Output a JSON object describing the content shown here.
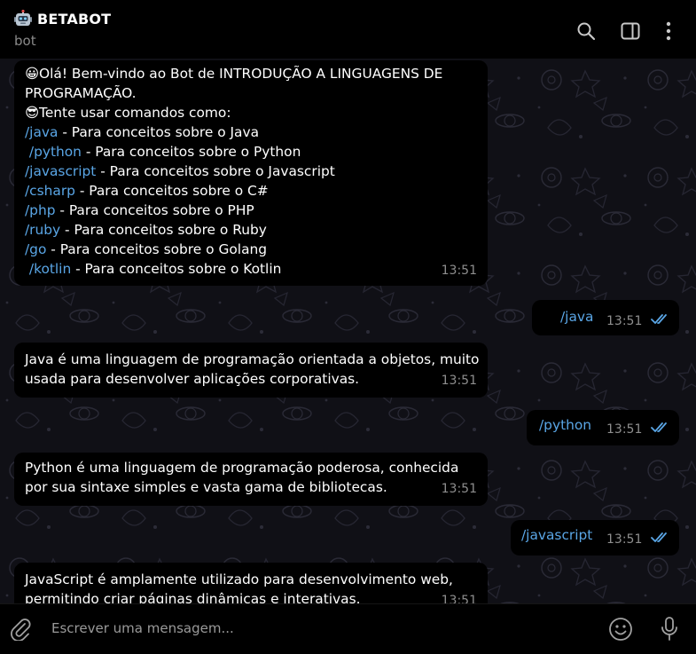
{
  "header": {
    "title": "BETABOT",
    "status": "bot",
    "bot_icon": "robot-face-icon",
    "actions": [
      "search-icon",
      "sidebar-toggle-icon",
      "more-vertical-icon"
    ]
  },
  "messages": [
    {
      "type": "incoming",
      "time": "13:51",
      "lines": [
        {
          "emoji": "😀",
          "text": "Olá! Bem-vindo ao Bot de INTRODUÇÃO A LINGUAGENS DE"
        },
        {
          "text": "PROGRAMAÇÃO."
        },
        {
          "emoji": "😎",
          "text": "Tente usar comandos como:"
        },
        {
          "cmd": "/java",
          "text": " - Para conceitos sobre o Java"
        },
        {
          "cmd": " /python",
          "text": " - Para conceitos sobre o Python"
        },
        {
          "cmd": "/javascript",
          "text": " - Para conceitos sobre o Javascript"
        },
        {
          "cmd": "/csharp",
          "text": " - Para conceitos sobre o C#"
        },
        {
          "cmd": "/php",
          "text": " - Para conceitos sobre o PHP"
        },
        {
          "cmd": "/ruby",
          "text": " - Para conceitos sobre o Ruby"
        },
        {
          "cmd": "/go",
          "text": " - Para conceitos sobre o Golang"
        },
        {
          "cmd": " /kotlin",
          "text": " - Para conceitos sobre o Kotlin"
        }
      ]
    },
    {
      "type": "outgoing",
      "text": "/java",
      "time": "13:51",
      "read": true
    },
    {
      "type": "incoming",
      "time": "13:51",
      "lines": [
        {
          "text": "Java é uma linguagem de programação orientada a objetos, muito"
        },
        {
          "text": "usada para desenvolver aplicações corporativas."
        }
      ]
    },
    {
      "type": "outgoing",
      "text": "/python",
      "time": "13:51",
      "read": true
    },
    {
      "type": "incoming",
      "time": "13:51",
      "lines": [
        {
          "text": "Python é uma linguagem de programação poderosa, conhecida"
        },
        {
          "text": "por sua sintaxe simples e vasta gama de bibliotecas."
        }
      ]
    },
    {
      "type": "outgoing",
      "text": "/javascript",
      "time": "13:51",
      "read": true
    },
    {
      "type": "incoming",
      "time": "13:51",
      "lines": [
        {
          "text": "JavaScript é amplamente utilizado para desenvolvimento web,"
        },
        {
          "text": "permitindo criar páginas dinâmicas e interativas."
        }
      ]
    }
  ],
  "composer": {
    "placeholder": "Escrever uma mensagem...",
    "attach_icon": "paperclip-icon",
    "emoji_icon": "smiley-icon",
    "mic_icon": "microphone-icon"
  },
  "colors": {
    "background": "#000000",
    "chat_wallpaper": "#101016",
    "link": "#5aa6e6",
    "time": "#8e8e8e",
    "read_check": "#5aa6e6"
  }
}
